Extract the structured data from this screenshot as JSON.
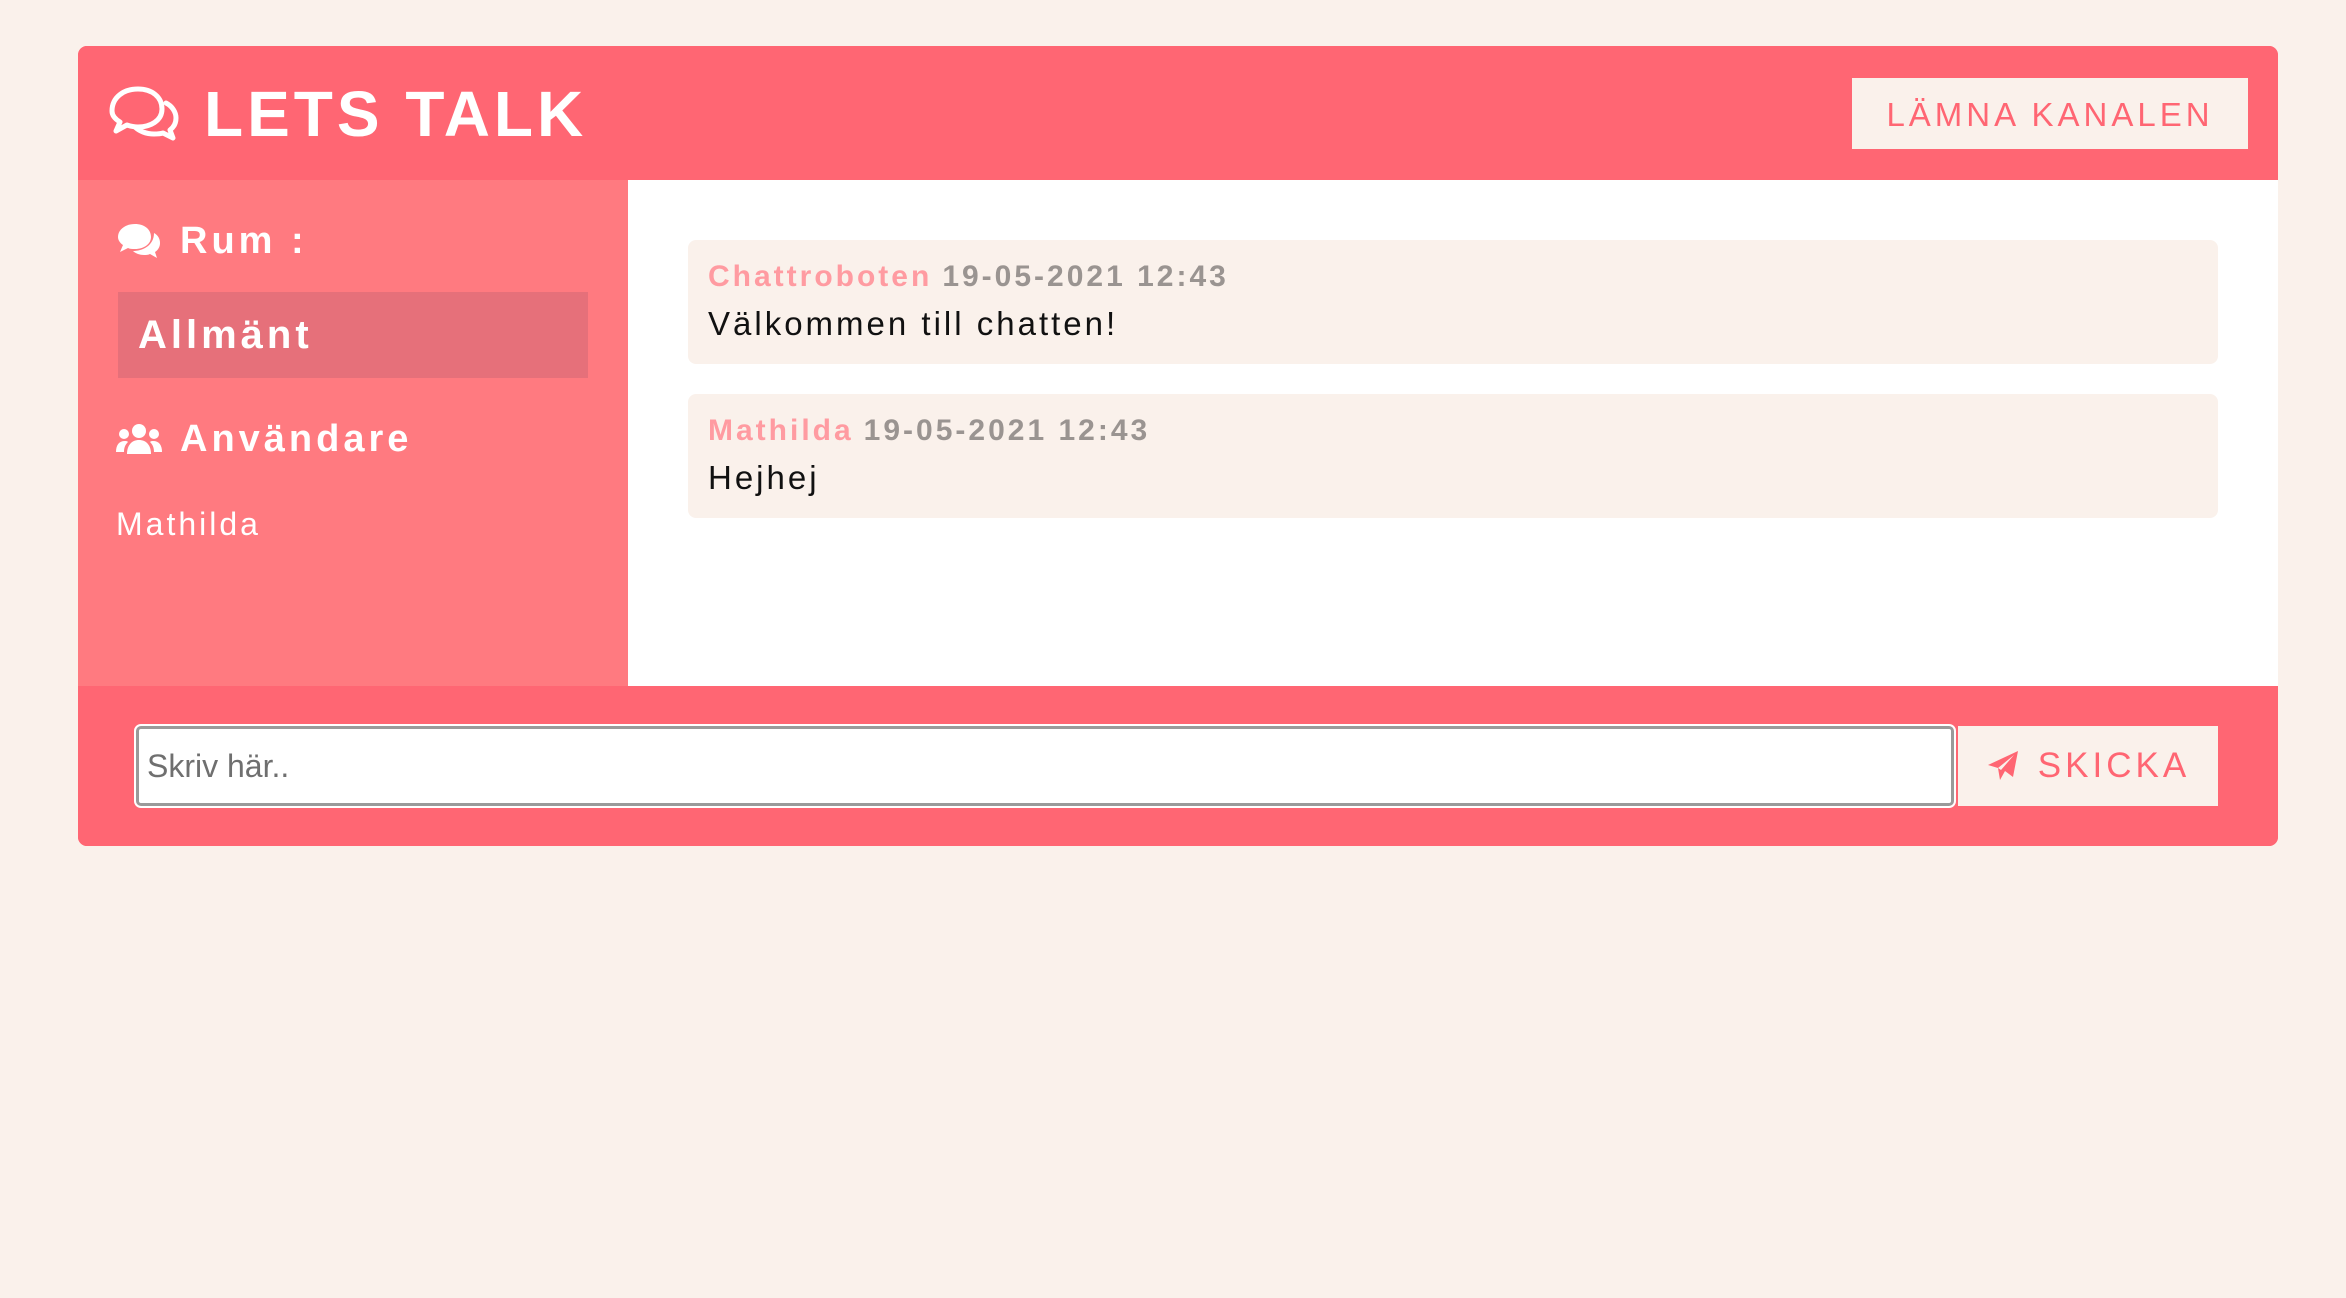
{
  "header": {
    "title": "LETS TALK",
    "icon": "comments-icon",
    "leave_label": "LÄMNA KANALEN"
  },
  "sidebar": {
    "rooms_heading": "Rum :",
    "rooms_icon": "comments-icon",
    "rooms": [
      {
        "label": "Allmänt",
        "active": true
      }
    ],
    "users_heading": "Användare",
    "users_icon": "users-icon",
    "users": [
      {
        "name": "Mathilda"
      }
    ]
  },
  "messages": [
    {
      "author": "Chattroboten",
      "time": "19-05-2021 12:43",
      "text": "Välkommen till chatten!"
    },
    {
      "author": "Mathilda",
      "time": "19-05-2021 12:43",
      "text": "Hejhej"
    }
  ],
  "composer": {
    "placeholder": "Skriv här..",
    "value": "",
    "send_label": "SKICKA",
    "send_icon": "paper-plane-icon"
  },
  "colors": {
    "page_background": "#faf1eb",
    "accent": "#ff6673",
    "sidebar": "#ff7a80",
    "active_room": "#e6707a",
    "author": "#ff9ba1",
    "timestamp": "#9a9491"
  }
}
